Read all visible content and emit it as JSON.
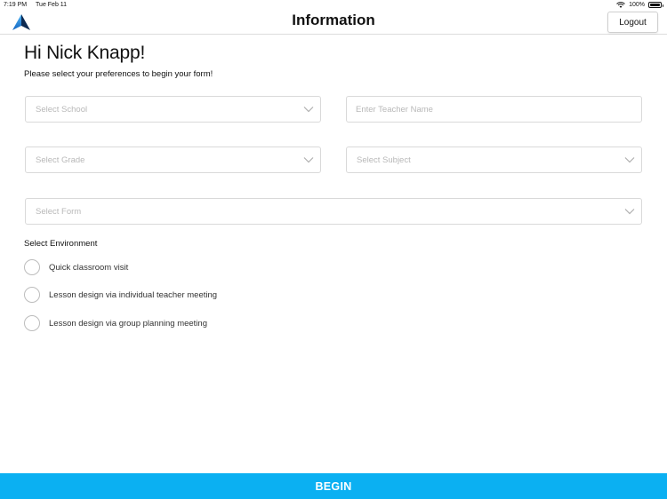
{
  "status_bar": {
    "time": "7:19 PM",
    "date": "Tue Feb 11",
    "battery": "100%",
    "battery_level": 1.0
  },
  "header": {
    "title": "Information",
    "logout_label": "Logout"
  },
  "greeting": "Hi Nick Knapp!",
  "subtitle": "Please select your preferences to begin your form!",
  "fields": {
    "school": {
      "placeholder": "Select School"
    },
    "teacher": {
      "placeholder": "Enter Teacher Name"
    },
    "grade": {
      "placeholder": "Select Grade"
    },
    "subject": {
      "placeholder": "Select Subject"
    },
    "form": {
      "placeholder": "Select Form"
    }
  },
  "environment": {
    "heading": "Select Environment",
    "options": [
      {
        "label": "Quick classroom visit",
        "selected": false
      },
      {
        "label": "Lesson design via individual teacher meeting",
        "selected": false
      },
      {
        "label": "Lesson design via group planning meeting",
        "selected": false
      }
    ]
  },
  "begin_label": "BEGIN",
  "colors": {
    "accent": "#0bb0f2",
    "logo_light": "#3fa9f5",
    "logo_dark": "#0d2a52",
    "placeholder": "#b8b8b8",
    "border": "#d9d9d9"
  },
  "icons": [
    "app-logo-icon",
    "wifi-icon",
    "battery-icon",
    "chevron-down-icon",
    "radio-circle-icon"
  ]
}
